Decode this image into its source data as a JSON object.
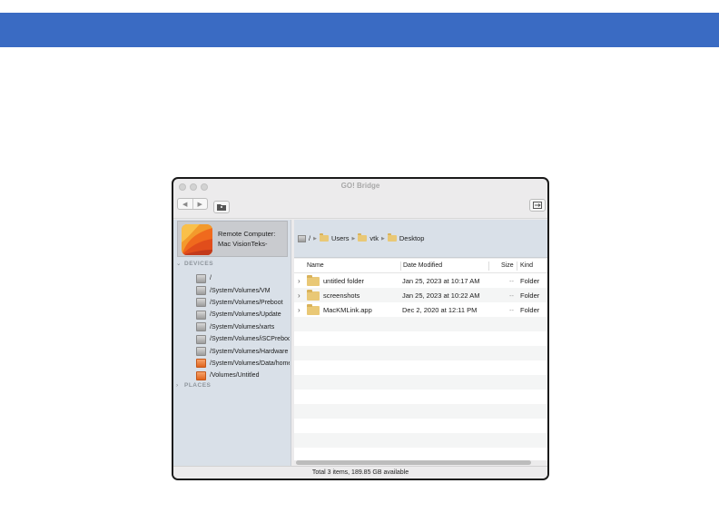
{
  "colors": {
    "slide_bar": "#3a6bc3",
    "sidebar_bg": "#d9e0e8",
    "folder": "#e9c876",
    "disk_orange": "#e0641e"
  },
  "window": {
    "title": "GO! Bridge",
    "toolbar": {
      "back_icon": "chevron-left-icon",
      "forward_icon": "chevron-right-icon",
      "new_folder_icon": "folder-icon",
      "action_icon": "window-icon"
    }
  },
  "sidebar": {
    "remote_line1": "Remote Computer:",
    "remote_line2": "Mac VisionTeks-",
    "devices_header": "DEVICES",
    "devices": [
      {
        "label": "/",
        "color": "grey"
      },
      {
        "label": "/System/Volumes/VM",
        "color": "grey"
      },
      {
        "label": "/System/Volumes/Preboot",
        "color": "grey"
      },
      {
        "label": "/System/Volumes/Update",
        "color": "grey"
      },
      {
        "label": "/System/Volumes/xarts",
        "color": "grey"
      },
      {
        "label": "/System/Volumes/iSCPreboot",
        "color": "grey"
      },
      {
        "label": "/System/Volumes/Hardware",
        "color": "grey"
      },
      {
        "label": "/System/Volumes/Data/home",
        "color": "orange"
      },
      {
        "label": "/Volumes/Untitled",
        "color": "orange"
      }
    ],
    "places_header": "PLACES"
  },
  "path": {
    "root": "/",
    "crumbs": [
      "Users",
      "vtk",
      "Desktop"
    ]
  },
  "list": {
    "columns": {
      "name": "Name",
      "date": "Date Modified",
      "size": "Size",
      "kind": "Kind"
    },
    "rows": [
      {
        "name": "untitled folder",
        "date": "Jan 25, 2023 at 10:17 AM",
        "size": "--",
        "kind": "Folder"
      },
      {
        "name": "screenshots",
        "date": "Jan 25, 2023 at 10:22 AM",
        "size": "--",
        "kind": "Folder"
      },
      {
        "name": "MacKMLink.app",
        "date": "Dec 2, 2020 at 12:11 PM",
        "size": "--",
        "kind": "Folder"
      }
    ]
  },
  "status": "Total 3 items, 189.85 GB available"
}
